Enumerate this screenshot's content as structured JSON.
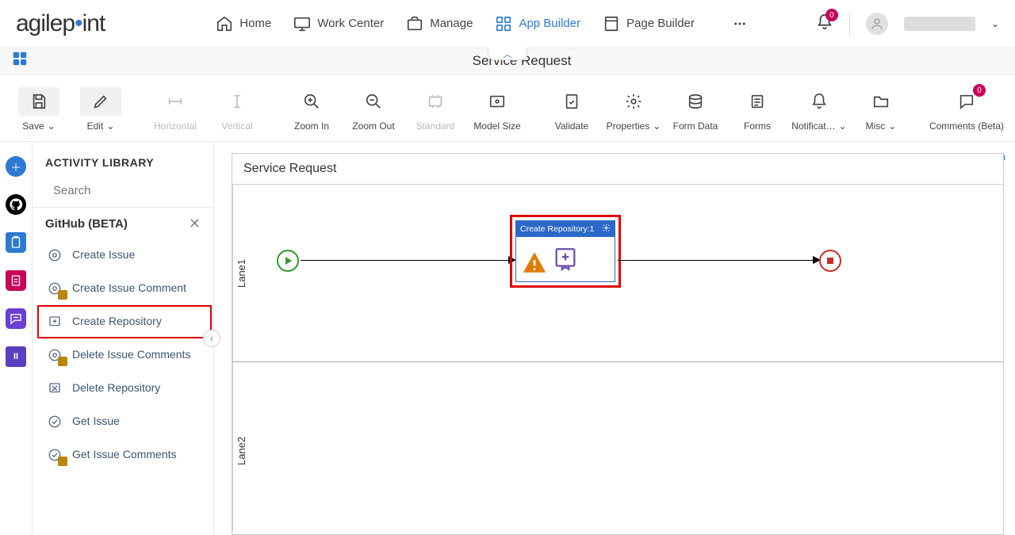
{
  "nav": {
    "home": "Home",
    "work_center": "Work Center",
    "manage": "Manage",
    "app_builder": "App Builder",
    "page_builder": "Page Builder",
    "notification_count": "0"
  },
  "titlebar": {
    "title": "Service Request"
  },
  "toolbar": {
    "save": "Save",
    "edit": "Edit",
    "horizontal": "Horizontal",
    "vertical": "Vertical",
    "zoom_in": "Zoom In",
    "zoom_out": "Zoom Out",
    "standard": "Standard",
    "model_size": "Model Size",
    "validate": "Validate",
    "properties": "Properties",
    "form_data": "Form Data",
    "forms": "Forms",
    "notifications": "Notificat…",
    "misc": "Misc",
    "comments": "Comments (Beta)",
    "comments_count": "0"
  },
  "sidebar": {
    "title": "ACTIVITY LIBRARY",
    "search_placeholder": "Search",
    "category": "GitHub (BETA)",
    "items": [
      "Create Issue",
      "Create Issue Comment",
      "Create Repository",
      "Delete Issue Comments",
      "Delete Repository",
      "Get Issue",
      "Get Issue Comments"
    ]
  },
  "canvas": {
    "title": "Service Request",
    "lanes": [
      "Lane1",
      "Lane2"
    ],
    "activity_title": "Create Repository:1"
  }
}
